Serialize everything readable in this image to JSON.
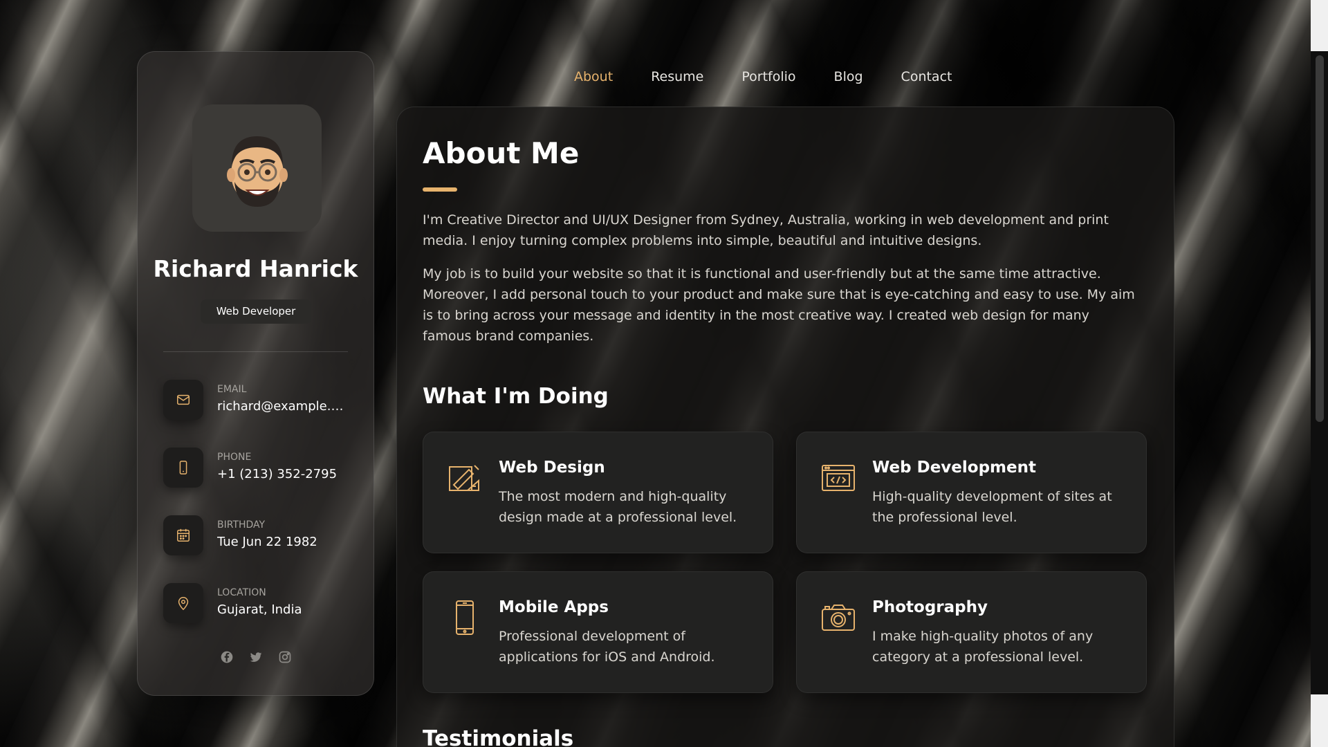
{
  "colors": {
    "accent": "#e7b36d",
    "panel": "#181716",
    "card": "#222221"
  },
  "profile": {
    "name": "Richard Hanrick",
    "role": "Web Developer",
    "avatar_icon": "memoji-avatar"
  },
  "contacts": [
    {
      "label": "EMAIL",
      "value": "richard@example.c...",
      "icon": "mail-icon"
    },
    {
      "label": "PHONE",
      "value": "+1 (213) 352-2795",
      "icon": "phone-icon"
    },
    {
      "label": "BIRTHDAY",
      "value": "Tue Jun 22 1982",
      "icon": "calendar-icon"
    },
    {
      "label": "LOCATION",
      "value": "Gujarat, India",
      "icon": "location-pin-icon"
    }
  ],
  "socials": [
    "facebook-icon",
    "twitter-icon",
    "instagram-icon"
  ],
  "nav": {
    "items": [
      "About",
      "Resume",
      "Portfolio",
      "Blog",
      "Contact"
    ],
    "active": "About"
  },
  "about": {
    "title": "About Me",
    "paragraphs": [
      "I'm Creative Director and UI/UX Designer from Sydney, Australia, working in web development and print media. I enjoy turning complex problems into simple, beautiful and intuitive designs.",
      "My job is to build your website so that it is functional and user-friendly but at the same time attractive. Moreover, I add personal touch to your product and make sure that is eye-catching and easy to use. My aim is to bring across your message and identity in the most creative way. I created web design for many famous brand companies."
    ]
  },
  "doing": {
    "title": "What I'm Doing",
    "services": [
      {
        "title": "Web Design",
        "text": "The most modern and high-quality design made at a professional level.",
        "icon": "design-icon"
      },
      {
        "title": "Web Development",
        "text": "High-quality development of sites at the professional level.",
        "icon": "code-window-icon"
      },
      {
        "title": "Mobile Apps",
        "text": "Professional development of applications for iOS and Android.",
        "icon": "smartphone-icon"
      },
      {
        "title": "Photography",
        "text": "I make high-quality photos of any category at a professional level.",
        "icon": "camera-icon"
      }
    ]
  },
  "testimonials": {
    "title": "Testimonials"
  }
}
